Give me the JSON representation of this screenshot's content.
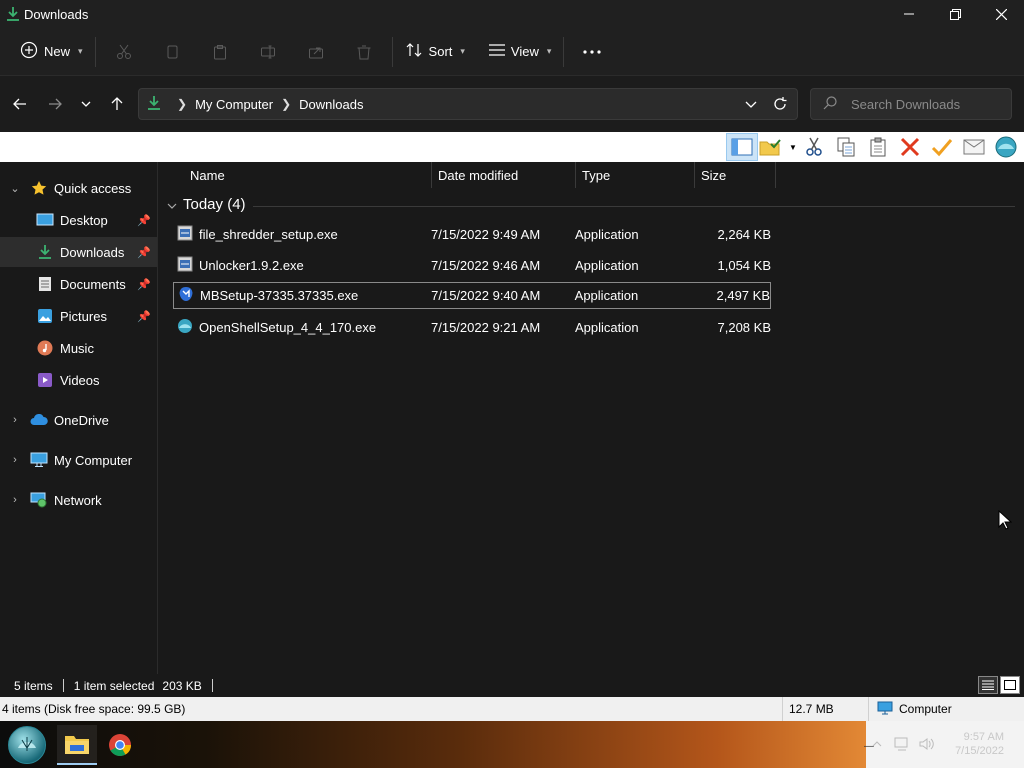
{
  "window": {
    "title": "Downloads"
  },
  "toolbar": {
    "new_label": "New",
    "sort_label": "Sort",
    "view_label": "View"
  },
  "address": {
    "segments": [
      "My Computer",
      "Downloads"
    ]
  },
  "search": {
    "placeholder": "Search Downloads"
  },
  "sidebar": {
    "items": [
      {
        "label": "Quick access"
      },
      {
        "label": "Desktop"
      },
      {
        "label": "Downloads"
      },
      {
        "label": "Documents"
      },
      {
        "label": "Pictures"
      },
      {
        "label": "Music"
      },
      {
        "label": "Videos"
      },
      {
        "label": "OneDrive"
      },
      {
        "label": "My Computer"
      },
      {
        "label": "Network"
      }
    ]
  },
  "columns": {
    "name": "Name",
    "date": "Date modified",
    "type": "Type",
    "size": "Size"
  },
  "group": {
    "label": "Today (4)"
  },
  "files": [
    {
      "name": "file_shredder_setup.exe",
      "date": "7/15/2022 9:49 AM",
      "type": "Application",
      "size": "2,264 KB"
    },
    {
      "name": "Unlocker1.9.2.exe",
      "date": "7/15/2022 9:46 AM",
      "type": "Application",
      "size": "1,054 KB"
    },
    {
      "name": "MBSetup-37335.37335.exe",
      "date": "7/15/2022 9:40 AM",
      "type": "Application",
      "size": "2,497 KB",
      "selected": true
    },
    {
      "name": "OpenShellSetup_4_4_170.exe",
      "date": "7/15/2022 9:21 AM",
      "type": "Application",
      "size": "7,208 KB"
    }
  ],
  "status": {
    "items": "5 items",
    "selection": "1 item selected",
    "selection_size": "203 KB"
  },
  "classic_status": {
    "info": "4 items (Disk free space: 99.5 GB)",
    "size": "12.7 MB",
    "location": "Computer"
  },
  "clock": {
    "time": "9:57 AM",
    "date": "7/15/2022"
  },
  "colors": {
    "accent": "#4cc2ff",
    "folder_green": "#3cb371",
    "shell_bar": "#ffffff",
    "delete_red": "#e03a1e",
    "check_orange": "#f0a020"
  }
}
